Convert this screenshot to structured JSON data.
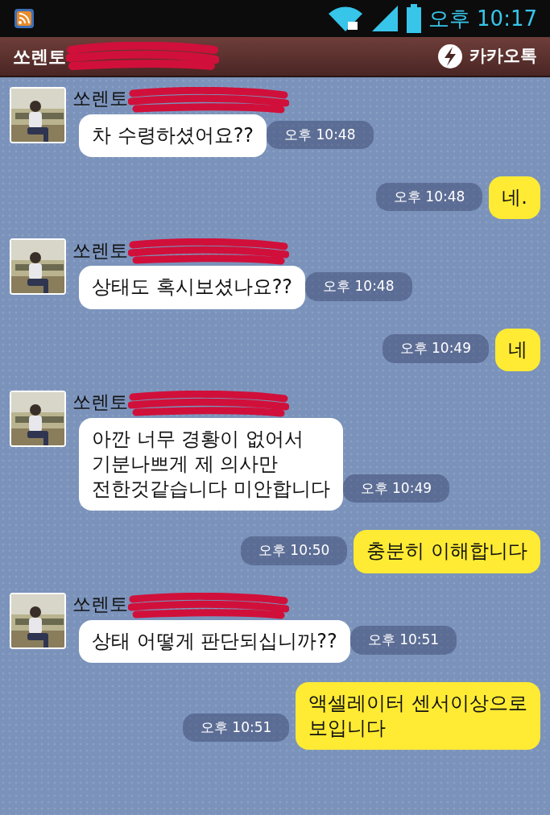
{
  "status_bar": {
    "time": "오후 10:17"
  },
  "header": {
    "title": "쏘렌토",
    "app_name": "카카오톡"
  },
  "messages": [
    {
      "kind": "incoming",
      "sender": "쏘렌토",
      "text": "차 수령하셨어요??",
      "time": "오후 10:48"
    },
    {
      "kind": "outgoing",
      "text": "네.",
      "time": "오후 10:48"
    },
    {
      "kind": "incoming",
      "sender": "쏘렌토",
      "text": "상태도 혹시보셨나요??",
      "time": "오후 10:48"
    },
    {
      "kind": "outgoing",
      "text": "네",
      "time": "오후 10:49"
    },
    {
      "kind": "incoming",
      "sender": "쏘렌토",
      "text": "아깐 너무 경황이 없어서\n기분나쁘게 제 의사만\n전한것같습니다 미안합니다",
      "time": "오후 10:49"
    },
    {
      "kind": "outgoing",
      "text": "충분히 이해합니다",
      "time": "오후 10:50"
    },
    {
      "kind": "incoming",
      "sender": "쏘렌토",
      "text": "상태 어떻게 판단되십니까??",
      "time": "오후 10:51"
    },
    {
      "kind": "outgoing",
      "text": "액셀레이터 센서이상으로\n보입니다",
      "time": "오후 10:51"
    }
  ]
}
